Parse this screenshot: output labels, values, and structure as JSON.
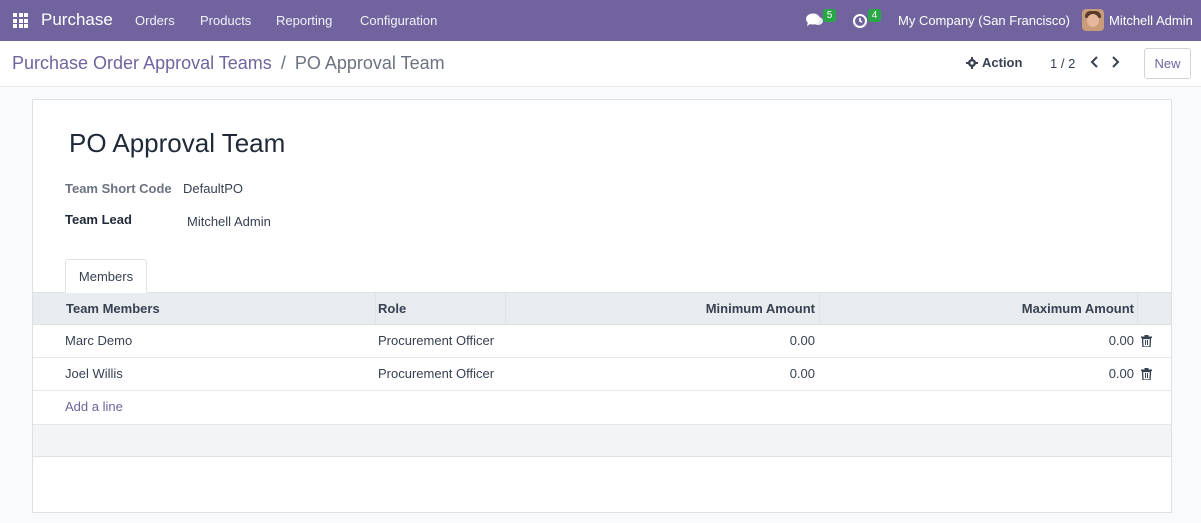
{
  "navbar": {
    "brand": "Purchase",
    "menu": [
      "Orders",
      "Products",
      "Reporting",
      "Configuration"
    ],
    "chat_count": "5",
    "activity_count": "4",
    "company": "My Company (San Francisco)",
    "user": "Mitchell Admin"
  },
  "control_panel": {
    "breadcrumb_parent": "Purchase Order Approval Teams",
    "breadcrumb_separator": "/",
    "breadcrumb_current": "PO Approval Team",
    "action_label": "Action",
    "pager_value": "1 / 2",
    "new_label": "New"
  },
  "form": {
    "title": "PO Approval Team",
    "short_code_label": "Team Short Code",
    "short_code_value": "DefaultPO",
    "team_lead_label": "Team Lead",
    "team_lead_value": "Mitchell Admin"
  },
  "tabs": {
    "members": "Members"
  },
  "table": {
    "columns": [
      "Team Members",
      "Role",
      "Minimum Amount",
      "Maximum Amount"
    ],
    "rows": [
      {
        "member": "Marc Demo",
        "role": "Procurement Officer",
        "min": "0.00",
        "max": "0.00"
      },
      {
        "member": "Joel Willis",
        "role": "Procurement Officer",
        "min": "0.00",
        "max": "0.00"
      }
    ],
    "add_line": "Add a line"
  },
  "colors": {
    "brand": "#71639e",
    "badge": "#28a745"
  }
}
